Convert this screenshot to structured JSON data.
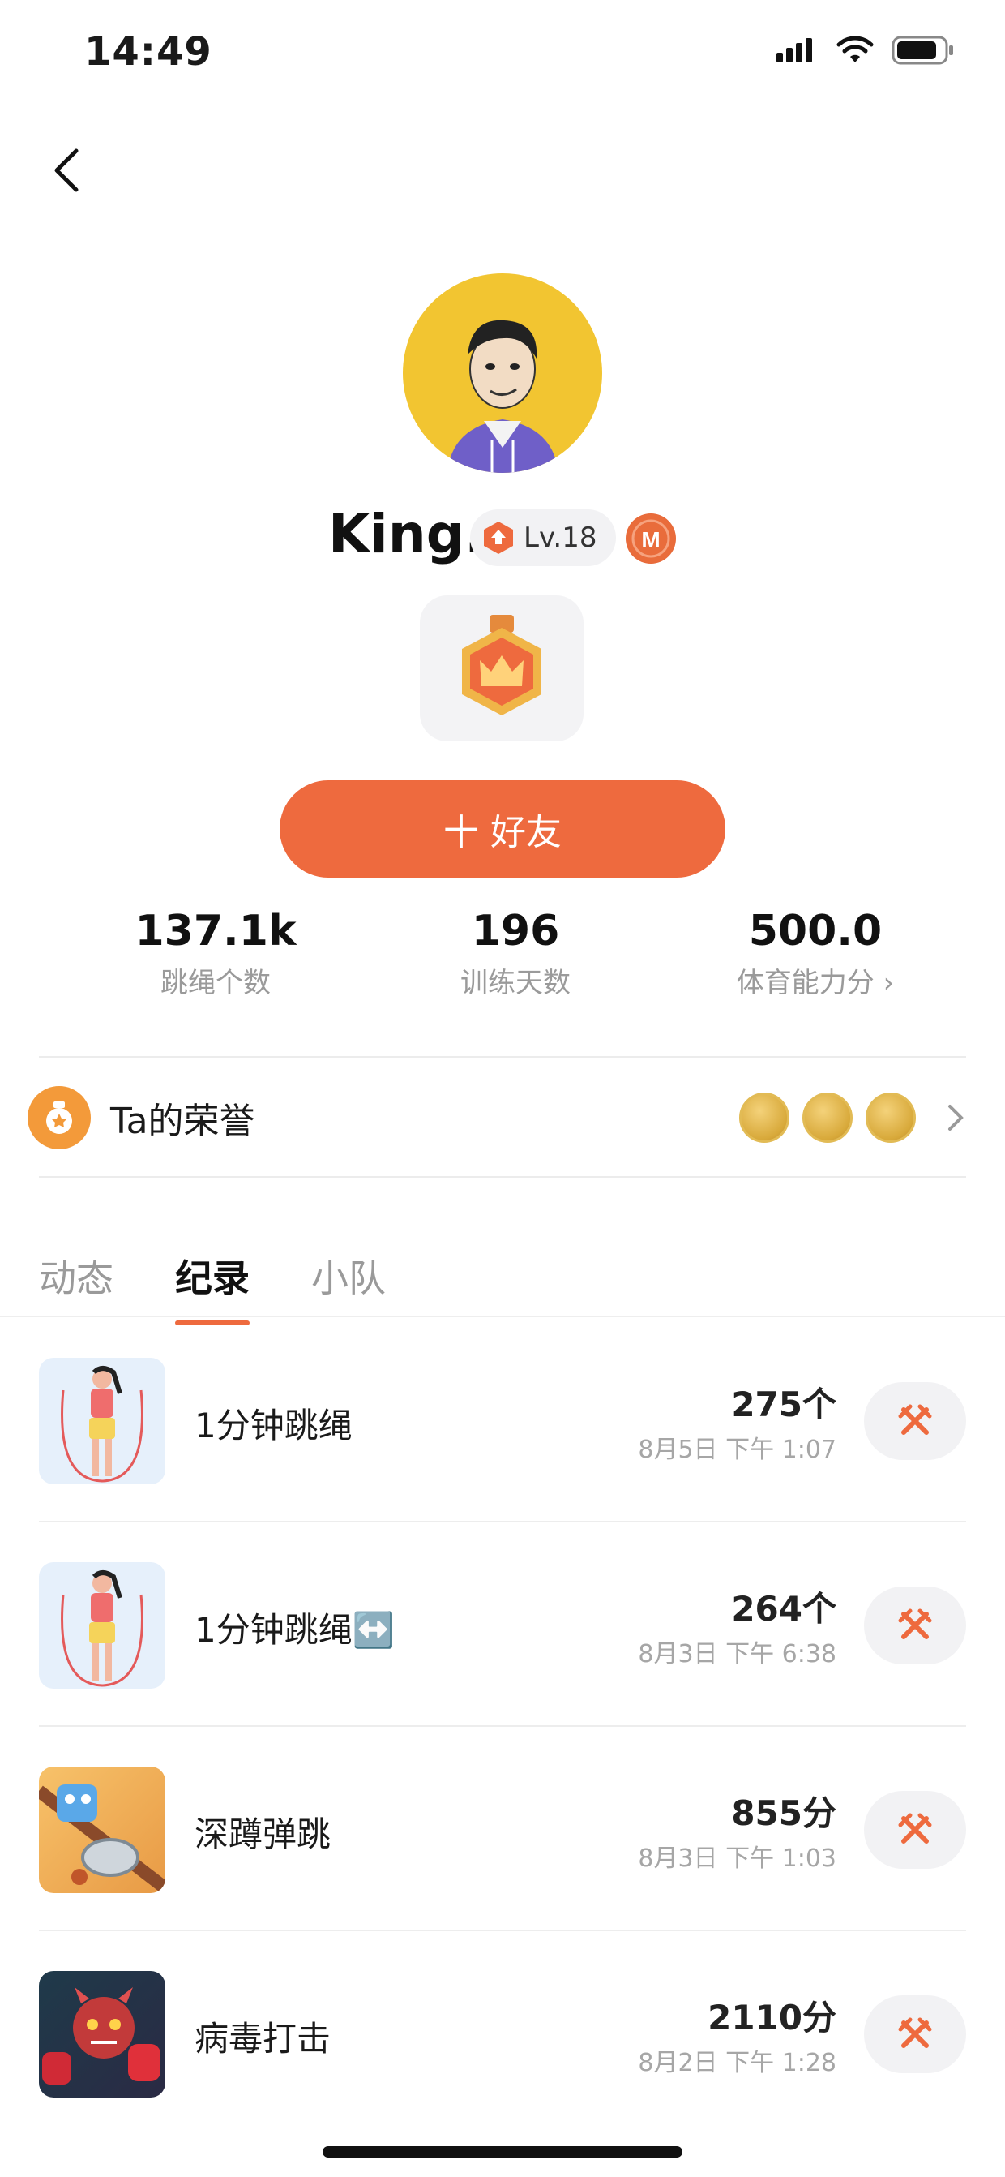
{
  "status_bar": {
    "time": "14:49"
  },
  "profile": {
    "username": "King.",
    "level": "Lv.18",
    "m_badge": "M",
    "add_friend_label": "十 好友"
  },
  "stats": [
    {
      "value": "137.1k",
      "label": "跳绳个数"
    },
    {
      "value": "196",
      "label": "训练天数"
    },
    {
      "value": "500.0",
      "label": "体育能力分 ›"
    }
  ],
  "honor": {
    "label": "Ta的荣誉"
  },
  "tabs": [
    {
      "label": "动态"
    },
    {
      "label": "纪录"
    },
    {
      "label": "小队"
    }
  ],
  "records": [
    {
      "title": "1分钟跳绳",
      "value": "275个",
      "date": "8月5日 下午 1:07"
    },
    {
      "title": "1分钟跳绳↔️",
      "value": "264个",
      "date": "8月3日 下午 6:38"
    },
    {
      "title": "深蹲弹跳",
      "value": "855分",
      "date": "8月3日 下午 1:03"
    },
    {
      "title": "病毒打击",
      "value": "2110分",
      "date": "8月2日 下午 1:28"
    }
  ],
  "colors": {
    "accent": "#ee6a3e",
    "avatar_bg": "#f2c531",
    "honor": "#f39a3a"
  }
}
